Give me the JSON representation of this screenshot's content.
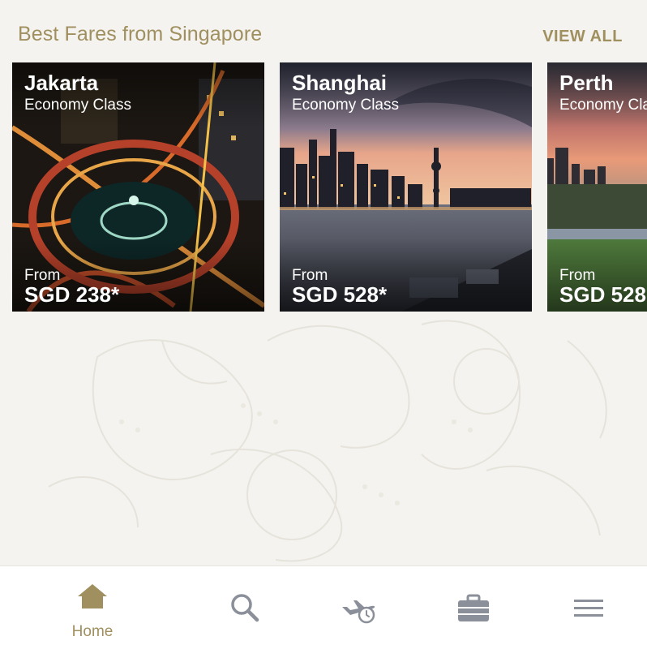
{
  "section": {
    "title": "Best Fares from Singapore",
    "view_all": "VIEW ALL"
  },
  "cards": [
    {
      "city": "Jakarta",
      "cabin": "Economy Class",
      "from": "From",
      "price": "SGD 238*"
    },
    {
      "city": "Shanghai",
      "cabin": "Economy Class",
      "from": "From",
      "price": "SGD 528*"
    },
    {
      "city": "Perth",
      "cabin": "Economy Class",
      "from": "From",
      "price": "SGD 528"
    }
  ],
  "nav": {
    "items": [
      {
        "label": "Home",
        "icon": "home-icon",
        "active": true
      },
      {
        "label": "",
        "icon": "search-icon",
        "active": false
      },
      {
        "label": "",
        "icon": "flight-status-icon",
        "active": false
      },
      {
        "label": "",
        "icon": "trips-icon",
        "active": false
      },
      {
        "label": "",
        "icon": "menu-icon",
        "active": false
      }
    ]
  },
  "colors": {
    "accent": "#a08f5f",
    "background": "#f4f3ef",
    "nav_inactive": "#8a8f99"
  }
}
